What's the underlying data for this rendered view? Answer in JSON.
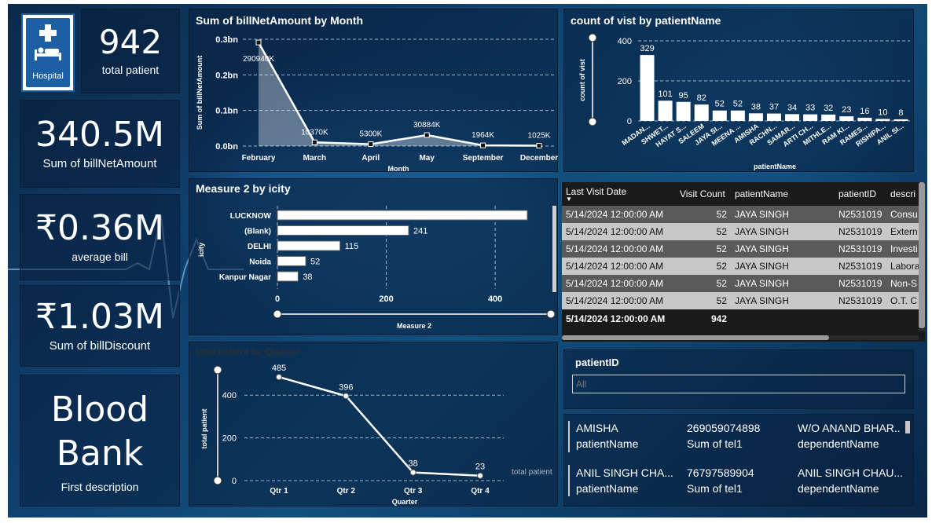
{
  "logo": {
    "text": "Hospital",
    "icon": "hospital-bed-icon"
  },
  "kpis": [
    {
      "value": "942",
      "label": "total patient"
    },
    {
      "value": "340.5M",
      "label": "Sum of billNetAmount"
    },
    {
      "value": "₹0.36M",
      "label": "average bill"
    },
    {
      "value": "₹1.03M",
      "label": "Sum of billDiscount"
    },
    {
      "value": "Blood Bank",
      "label": "First description"
    }
  ],
  "chart_month": {
    "title": "Sum of billNetAmount by Month",
    "chart_data": {
      "type": "area",
      "title": "Sum of billNetAmount by Month",
      "xlabel": "Month",
      "ylabel": "Sum of billNetAmount",
      "categories": [
        "February",
        "March",
        "April",
        "May",
        "September",
        "December"
      ],
      "values": [
        290940000,
        10370000,
        5300000,
        30884000,
        1964000,
        1025000
      ],
      "data_labels": [
        "290940K",
        "10370K",
        "5300K",
        "30884K",
        "1964K",
        "1025K"
      ],
      "y_ticks": [
        "0.0bn",
        "0.1bn",
        "0.2bn",
        "0.3bn"
      ],
      "ylim": [
        0,
        300000000
      ]
    }
  },
  "chart_visit": {
    "title": "count of vist by patientName",
    "chart_data": {
      "type": "bar",
      "title": "count of vist by patientName",
      "xlabel": "patientName",
      "ylabel": "count of vist",
      "categories": [
        "MADAN...",
        "SHWET...",
        "HAYAT S...",
        "SALEEM",
        "JAYA SI...",
        "MEENA ...",
        "AMISHA",
        "RACHN...",
        "SAMAR...",
        "ARTI CH...",
        "MITHLE...",
        "RAM KI...",
        "RAMES...",
        "RISHIPA...",
        "ANIL SI..."
      ],
      "values": [
        329,
        101,
        95,
        82,
        52,
        52,
        38,
        37,
        34,
        33,
        32,
        23,
        16,
        10,
        8
      ],
      "y_ticks": [
        "0",
        "200",
        "400"
      ],
      "ylim": [
        0,
        400
      ]
    }
  },
  "chart_city": {
    "title": "Measure 2 by icity",
    "chart_data": {
      "type": "bar",
      "orientation": "horizontal",
      "title": "Measure 2 by icity",
      "xlabel": "Measure 2",
      "ylabel": "icity",
      "categories": [
        "LUCKNOW",
        "(Blank)",
        "DELHI",
        "Noida",
        "Kanpur Nagar"
      ],
      "values": [
        459,
        241,
        115,
        52,
        38
      ],
      "data_labels": [
        "",
        "241",
        "115",
        "52",
        "38"
      ],
      "x_ticks": [
        "0",
        "200",
        "400"
      ],
      "xlim": [
        0,
        459
      ]
    }
  },
  "chart_quarter": {
    "title": "total patient by Quarter",
    "chart_data": {
      "type": "line",
      "title": "total patient by Quarter",
      "xlabel": "Quarter",
      "ylabel": "total patient",
      "categories": [
        "Qtr 1",
        "Qtr 2",
        "Qtr 3",
        "Qtr 4"
      ],
      "values": [
        485,
        396,
        38,
        23
      ],
      "y_ticks": [
        "0",
        "200",
        "400"
      ],
      "ylim": [
        0,
        500
      ],
      "legend_label": "total patient"
    }
  },
  "table": {
    "columns": [
      "Last Visit Date",
      "Visit Count",
      "patientName",
      "patientID",
      "descri"
    ],
    "rows": [
      [
        "5/14/2024 12:00:00 AM",
        "52",
        "JAYA SINGH",
        "N2531019",
        "Consu"
      ],
      [
        "5/14/2024 12:00:00 AM",
        "52",
        "JAYA SINGH",
        "N2531019",
        "Extern"
      ],
      [
        "5/14/2024 12:00:00 AM",
        "52",
        "JAYA SINGH",
        "N2531019",
        "Investi"
      ],
      [
        "5/14/2024 12:00:00 AM",
        "52",
        "JAYA SINGH",
        "N2531019",
        "Labora"
      ],
      [
        "5/14/2024 12:00:00 AM",
        "52",
        "JAYA SINGH",
        "N2531019",
        "Non-S"
      ],
      [
        "5/14/2024 12:00:00 AM",
        "52",
        "JAYA SINGH",
        "N2531019",
        "O.T. C"
      ]
    ],
    "total": [
      "5/14/2024 12:00:00 AM",
      "942",
      "",
      "",
      ""
    ]
  },
  "slicer": {
    "title": "patientID",
    "placeholder": "All"
  },
  "multirow": [
    [
      {
        "value": "AMISHA",
        "label": "patientName"
      },
      {
        "value": "269059074898",
        "label": "Sum of tel1"
      },
      {
        "value": "W/O ANAND BHAR..",
        "label": "dependentName"
      }
    ],
    [
      {
        "value": "ANIL SINGH CHA...",
        "label": "patientName"
      },
      {
        "value": "76797589904",
        "label": "Sum of tel1"
      },
      {
        "value": "ANIL SINGH CHAU...",
        "label": "dependentName"
      }
    ]
  ],
  "colors": {
    "accent": "#ffffff",
    "panel": "#0b2a4a",
    "grid": "#8fa9c4",
    "row_dark": "#5a5a5a",
    "row_light": "#c8c8c8"
  }
}
